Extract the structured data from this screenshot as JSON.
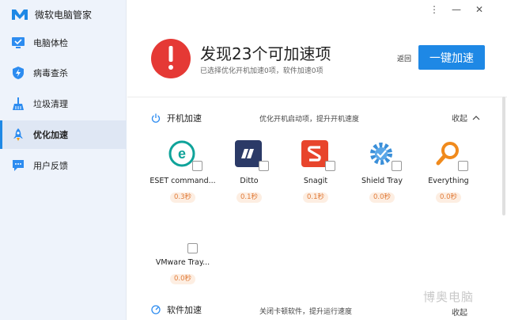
{
  "app": {
    "title": "微软电脑管家"
  },
  "sidebar": {
    "items": [
      {
        "label": "电脑体检",
        "icon": "monitor-check-icon"
      },
      {
        "label": "病毒查杀",
        "icon": "shield-icon"
      },
      {
        "label": "垃圾清理",
        "icon": "broom-icon"
      },
      {
        "label": "优化加速",
        "icon": "rocket-icon",
        "active": true
      },
      {
        "label": "用户反馈",
        "icon": "feedback-icon"
      }
    ]
  },
  "window_controls": {
    "menu": "⋮",
    "minimize": "—",
    "close": "✕"
  },
  "hero": {
    "title": "发现23个可加速项",
    "subtitle": "已选择优化开机加速0项，软件加速0项",
    "back_label": "返回",
    "action_label": "一键加速"
  },
  "startup_section": {
    "title": "开机加速",
    "description": "优化开机启动项，提升开机速度",
    "collapse_label": "收起",
    "apps": [
      {
        "name": "ESET command...",
        "time": "0.3秒",
        "icon": "eset-icon",
        "checked": false
      },
      {
        "name": "Ditto",
        "time": "0.1秒",
        "icon": "ditto-icon",
        "checked": false
      },
      {
        "name": "Snagit",
        "time": "0.1秒",
        "icon": "snagit-icon",
        "checked": false
      },
      {
        "name": "Shield Tray",
        "time": "0.0秒",
        "icon": "gear-icon",
        "checked": false
      },
      {
        "name": "Everything",
        "time": "0.0秒",
        "icon": "magnifier-icon",
        "checked": false
      },
      {
        "name": "VMware Tray...",
        "time": "0.0秒",
        "icon": "vmware-icon",
        "checked": false
      }
    ]
  },
  "software_section": {
    "title": "软件加速",
    "description": "关闭卡顿软件，提升运行速度",
    "collapse_label": "收起"
  },
  "watermark": "博奥电脑",
  "colors": {
    "accent": "#1e88e5",
    "alert": "#e53935",
    "time_badge_bg": "#fdeee2",
    "time_badge_text": "#e07b39"
  }
}
